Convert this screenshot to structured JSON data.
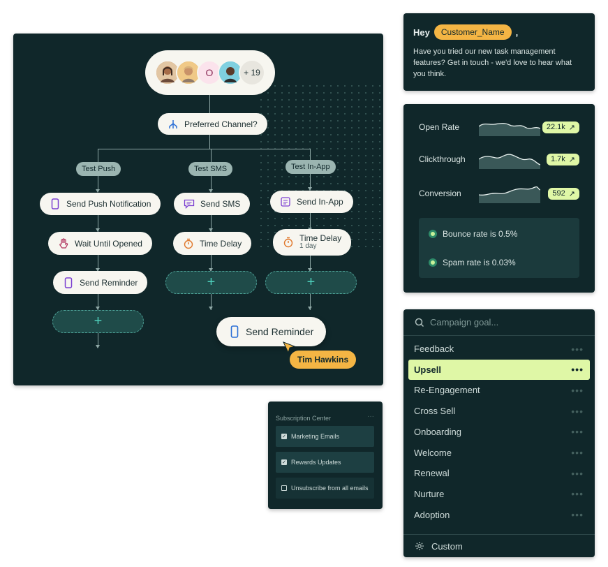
{
  "flow": {
    "avatars_more": "+ 19",
    "avatar_initial": "O",
    "channel_label": "Preferred Channel?",
    "branches": {
      "push": {
        "tag": "Test Push",
        "step1": "Send Push Notification",
        "step2": "Wait Until Opened",
        "step3": "Send Reminder"
      },
      "sms": {
        "tag": "Test SMS",
        "step1": "Send SMS",
        "step2": "Time Delay"
      },
      "inapp": {
        "tag": "Test In-App",
        "step1": "Send In-App",
        "step2": "Time Delay",
        "step2_sub": "1 day"
      }
    },
    "big_reminder": "Send Reminder",
    "cursor_user": "Tim Hawkins",
    "add_symbol": "+"
  },
  "message": {
    "greeting": "Hey",
    "variable": "Customer_Name",
    "comma": ",",
    "body": "Have you tried our new task management features? Get in touch - we'd love to hear what you think."
  },
  "stats": {
    "rows": [
      {
        "label": "Open Rate",
        "value": "22.1k"
      },
      {
        "label": "Clickthrough",
        "value": "1.7k"
      },
      {
        "label": "Conversion",
        "value": "592"
      }
    ],
    "bounce": "Bounce rate is 0.5%",
    "spam": "Spam rate is 0.03%"
  },
  "goals": {
    "search_placeholder": "Campaign goal...",
    "items": [
      "Feedback",
      "Upsell",
      "Re-Engagement",
      "Cross Sell",
      "Onboarding",
      "Welcome",
      "Renewal",
      "Nurture",
      "Adoption"
    ],
    "selected": "Upsell",
    "more": "•••",
    "custom": "Custom"
  },
  "subscription": {
    "title": "Subscription Center",
    "title_more": "···",
    "items": [
      {
        "label": "Marketing Emails",
        "checked": true
      },
      {
        "label": "Rewards Updates",
        "checked": true
      },
      {
        "label": "Unsubscribe from all emails",
        "checked": false
      }
    ]
  },
  "colors": {
    "panel": "#10272a",
    "accent_green": "#dff7a6",
    "accent_yellow": "#f4b544",
    "teal": "#4fd0bc"
  }
}
